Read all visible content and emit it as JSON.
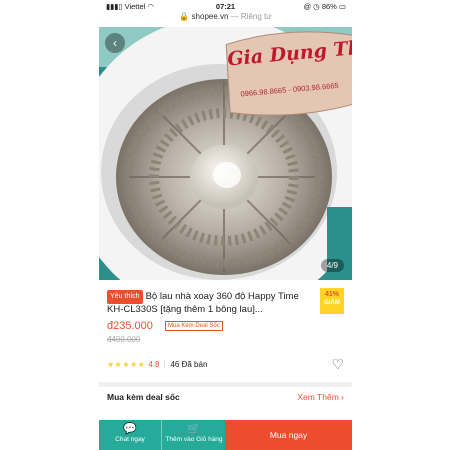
{
  "status_bar": {
    "carrier": "Viettel",
    "time": "07:21",
    "battery": "86%"
  },
  "url_bar": {
    "host": "shopee.vn",
    "mode": "— Riêng tư"
  },
  "product_image": {
    "counter": "4/9",
    "watermark_title": "Gia Dụng Thy Hà",
    "watermark_phone": "0966.98.8665 - 0903.98.6665"
  },
  "product": {
    "badge": "Yêu thích",
    "title": "Bộ lau nhà xoay 360 độ Happy Time KH-CL330S [tặng thêm 1 bông lau]...",
    "discount": "41%",
    "discount_label": "GIẢM",
    "price": "đ235.000",
    "deal_tag": "Mua Kèm Deal Sốc",
    "old_price": "đ400.000",
    "stars": "★★★★★",
    "rating": "4.8",
    "sold": "46 Đã bán"
  },
  "combo": {
    "label": "Mua kèm deal sốc",
    "more": "Xem Thêm"
  },
  "bottom_bar": {
    "chat": "Chat ngay",
    "add_to_cart": "Thêm vào Giỏ hàng",
    "buy": "Mua ngay"
  },
  "colors": {
    "accent": "#ee4d2d",
    "teal": "#26aa99",
    "star": "#ffce3d"
  }
}
